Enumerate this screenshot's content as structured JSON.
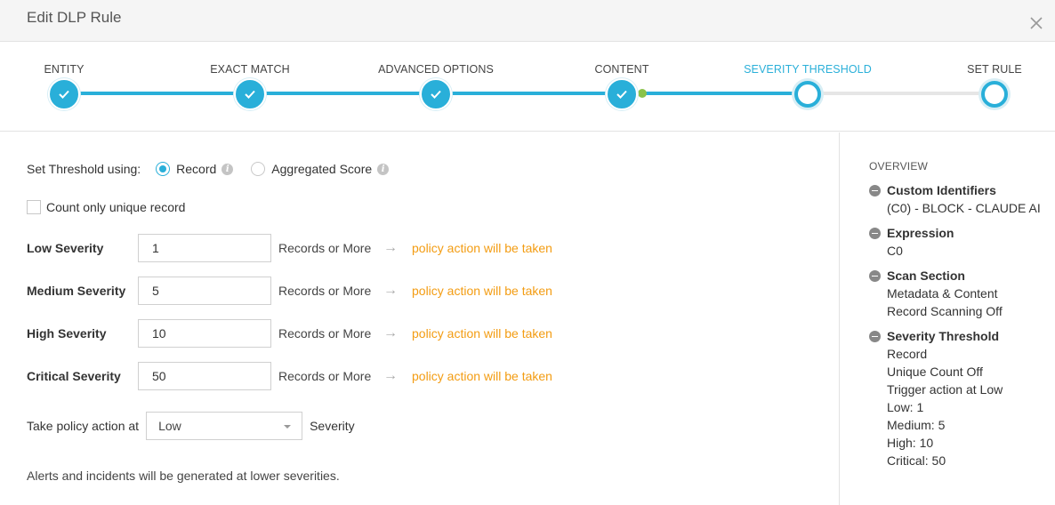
{
  "dialog": {
    "title": "Edit DLP Rule"
  },
  "wizard": {
    "steps": [
      {
        "label": "ENTITY",
        "state": "done"
      },
      {
        "label": "EXACT MATCH",
        "state": "done"
      },
      {
        "label": "ADVANCED OPTIONS",
        "state": "done"
      },
      {
        "label": "CONTENT",
        "state": "done"
      },
      {
        "label": "SEVERITY THRESHOLD",
        "state": "active"
      },
      {
        "label": "SET RULE",
        "state": "pending"
      }
    ],
    "colors": {
      "accent": "#29afd9",
      "marker": "#8bc34a",
      "track_pending": "#e6e6e6"
    }
  },
  "threshold": {
    "lead": "Set Threshold using:",
    "options": [
      {
        "label": "Record",
        "checked": true
      },
      {
        "label": "Aggregated Score",
        "checked": false
      }
    ],
    "info_icon": "i"
  },
  "unique": {
    "label": "Count only unique record",
    "checked": false
  },
  "severities": [
    {
      "label": "Low Severity",
      "value": "1",
      "suffix": "Records or More",
      "arrow": "→",
      "action": "policy action will be taken"
    },
    {
      "label": "Medium Severity",
      "value": "5",
      "suffix": "Records or More",
      "arrow": "→",
      "action": "policy action will be taken"
    },
    {
      "label": "High Severity",
      "value": "10",
      "suffix": "Records or More",
      "arrow": "→",
      "action": "policy action will be taken"
    },
    {
      "label": "Critical Severity",
      "value": "50",
      "suffix": "Records or More",
      "arrow": "→",
      "action": "policy action will be taken"
    }
  ],
  "take_action": {
    "prefix": "Take policy action at",
    "selected": "Low",
    "suffix": "Severity"
  },
  "note": "Alerts and incidents will be generated at lower severities.",
  "overview": {
    "title": "OVERVIEW",
    "sections": [
      {
        "heading": "Custom Identifiers",
        "lines": [
          "(C0) - BLOCK - CLAUDE AI"
        ]
      },
      {
        "heading": "Expression",
        "lines": [
          "C0"
        ]
      },
      {
        "heading": "Scan Section",
        "lines": [
          "Metadata & Content",
          "Record Scanning Off"
        ]
      },
      {
        "heading": "Severity Threshold",
        "lines": [
          "Record",
          "Unique Count Off",
          "Trigger action at Low",
          "Low: 1",
          "Medium: 5",
          "High: 10",
          "Critical: 50"
        ]
      }
    ]
  }
}
